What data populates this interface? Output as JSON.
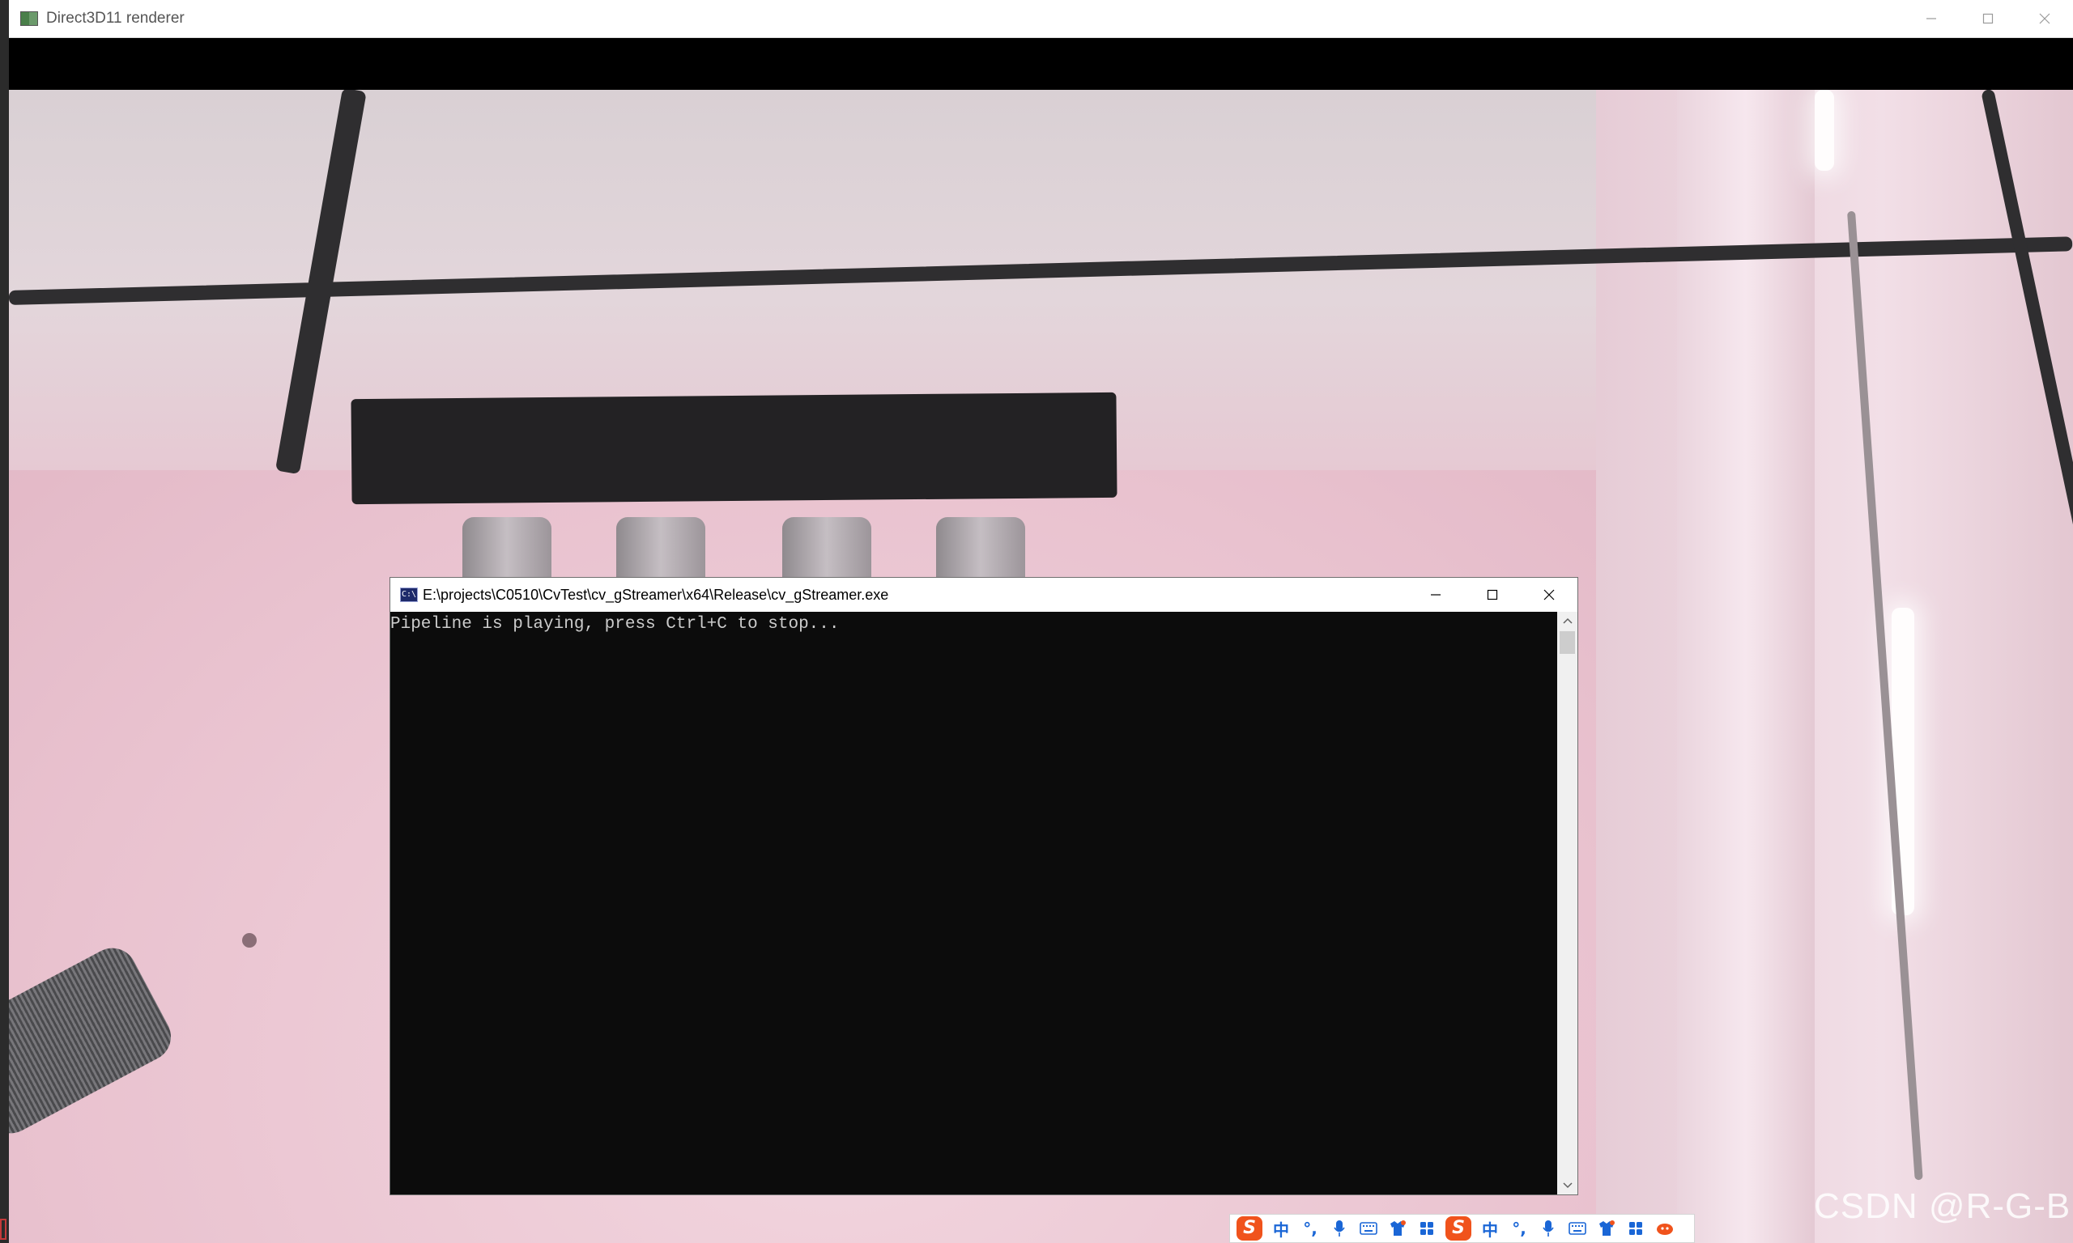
{
  "renderer": {
    "title": "Direct3D11 renderer",
    "icon": "app-window-icon",
    "caption_buttons": [
      "minimize-icon",
      "maximize-icon",
      "close-icon"
    ]
  },
  "console": {
    "title": "E:\\projects\\C0510\\CvTest\\cv_gStreamer\\x64\\Release\\cv_gStreamer.exe",
    "icon_text": "C:\\",
    "output_line": "Pipeline is playing, press Ctrl+C to stop..."
  },
  "ime_toolbar": {
    "groups": [
      {
        "logo": "S",
        "mode": "中",
        "punct": "°,",
        "icons": [
          "microphone-icon",
          "keyboard-icon",
          "skin-icon",
          "toolbox-icon"
        ]
      },
      {
        "logo": "S",
        "mode": "中",
        "punct": "°,",
        "icons": [
          "microphone-icon",
          "keyboard-icon",
          "skin-icon",
          "toolbox-icon",
          "mascot-icon"
        ]
      }
    ]
  },
  "watermark": "CSDN @R-G-B",
  "colors": {
    "console_bg": "#0c0c0c",
    "console_text": "#cccccc",
    "ime_blue": "#1a66d6",
    "ime_logo": "#f0531c"
  }
}
